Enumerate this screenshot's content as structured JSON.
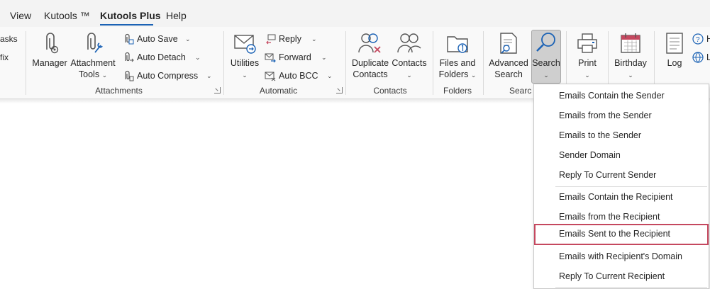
{
  "tabs": [
    {
      "label": "View",
      "active": false
    },
    {
      "label": "Kutools ™",
      "active": false
    },
    {
      "label": "Kutools Plus",
      "active": true
    },
    {
      "label": "Help",
      "active": false
    }
  ],
  "accent_color": "#1b62b5",
  "hover_border_color": "#c5485f",
  "partial_left": {
    "line1": "asks",
    "line2": "fix"
  },
  "attachments": {
    "group_label": "Attachments",
    "manager_label": "Manager",
    "attachment_tools_label_1": "Attachment",
    "attachment_tools_label_2": "Tools",
    "auto_save": "Auto Save",
    "auto_detach": "Auto Detach",
    "auto_compress": "Auto Compress"
  },
  "automatic": {
    "group_label": "Automatic",
    "utilities_label": "Utilities",
    "reply": "Reply",
    "forward": "Forward",
    "auto_bcc": "Auto BCC"
  },
  "contacts": {
    "group_label": "Contacts",
    "duplicate_label_1": "Duplicate",
    "duplicate_label_2": "Contacts",
    "contacts_label": "Contacts"
  },
  "folders": {
    "group_label": "Folders",
    "files_label_1": "Files and",
    "files_label_2": "Folders"
  },
  "search_group": {
    "group_label": "Searc",
    "advanced_label_1": "Advanced",
    "advanced_label_2": "Search",
    "search_label": "Search"
  },
  "print_label": "Print",
  "birthday_label": "Birthday",
  "log_label": "Log",
  "partial_right": {
    "line1": "H",
    "line2": "L"
  },
  "search_menu": {
    "items": [
      "Emails Contain the Sender",
      "Emails from the Sender",
      "Emails to the Sender",
      "Sender Domain",
      "Reply To Current Sender",
      "Emails Contain the Recipient",
      "Emails from the Recipient",
      "Emails Sent to the Recipient",
      "Emails with Recipient's Domain",
      "Reply To Current Recipient"
    ],
    "hovered_item": "Emails Sent to the Recipient"
  },
  "icons": [
    "paperclip-gear-icon",
    "paperclip-wrench-icon",
    "mail-forward-icon",
    "people-remove-icon",
    "people-icon",
    "folder-number-icon",
    "document-search-icon",
    "magnifier-icon",
    "printer-icon",
    "calendar-icon",
    "log-icon",
    "help-icon",
    "globe-icon"
  ]
}
